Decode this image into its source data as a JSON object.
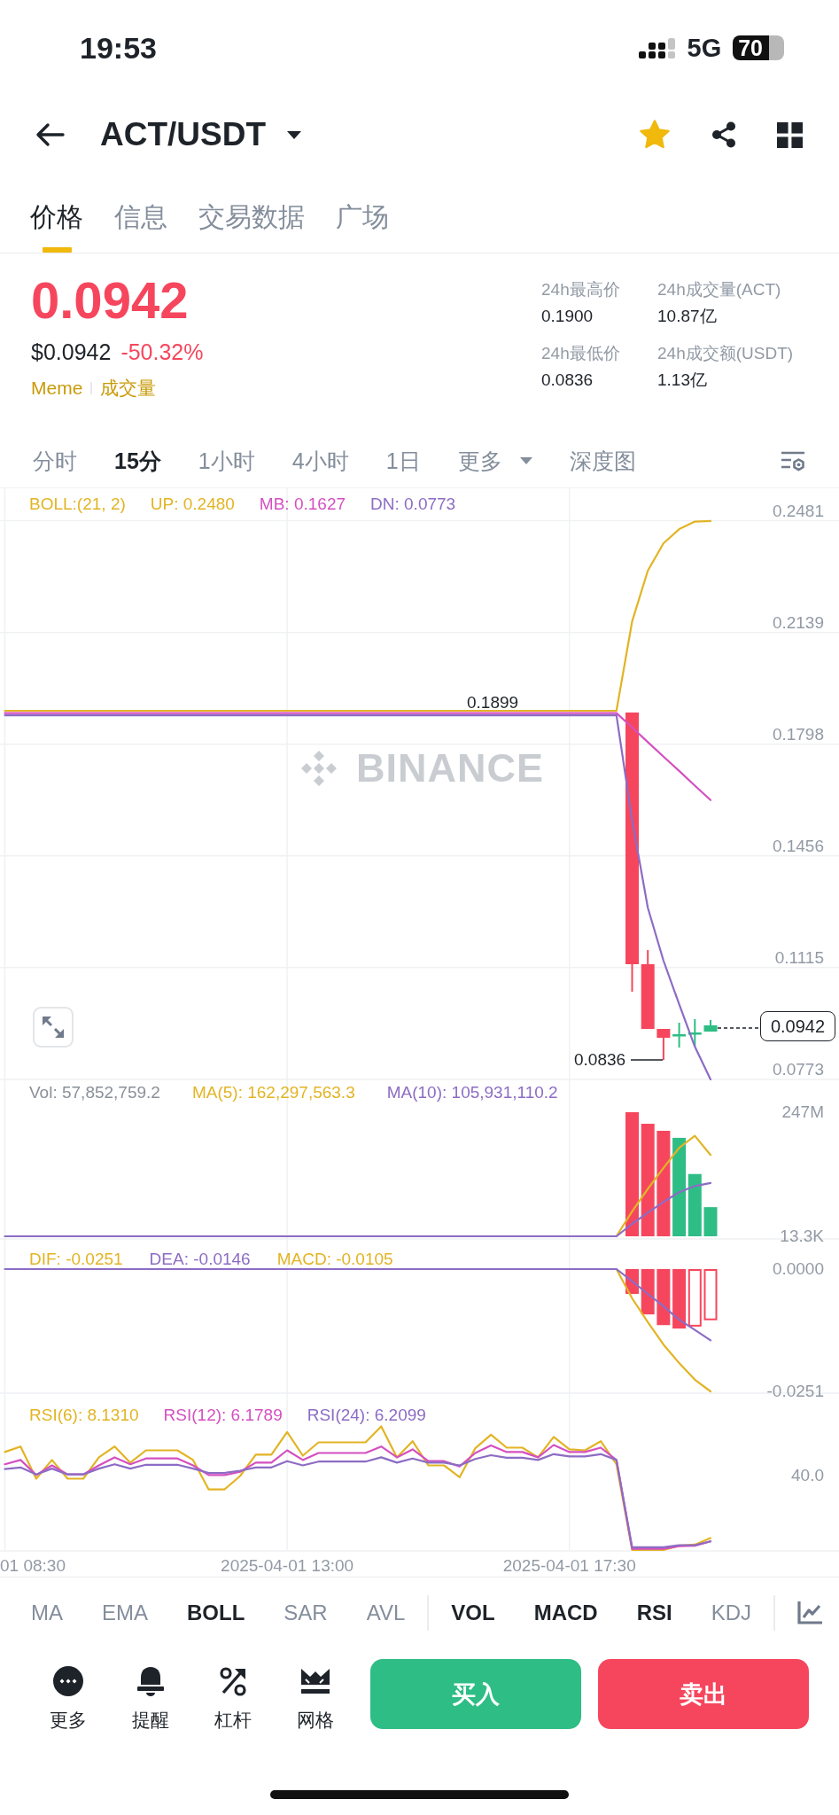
{
  "status_bar": {
    "time": "19:53",
    "network": "5G",
    "battery": "70"
  },
  "header": {
    "pair": "ACT/USDT",
    "favorite": true
  },
  "tabs": [
    {
      "label": "价格",
      "selected": true
    },
    {
      "label": "信息",
      "selected": false
    },
    {
      "label": "交易数据",
      "selected": false
    },
    {
      "label": "广场",
      "selected": false
    }
  ],
  "ticker": {
    "price": "0.0942",
    "usd_price": "$0.0942",
    "change": "-50.32%",
    "down": true,
    "tags": [
      "Meme",
      "成交量"
    ],
    "stats": [
      {
        "label": "24h最高价",
        "value": "0.1900"
      },
      {
        "label": "24h成交量(ACT)",
        "value": "10.87亿"
      },
      {
        "label": "24h最低价",
        "value": "0.0836"
      },
      {
        "label": "24h成交额(USDT)",
        "value": "1.13亿"
      }
    ]
  },
  "intervals": [
    {
      "label": "分时",
      "selected": false,
      "kind": "tab"
    },
    {
      "label": "15分",
      "selected": true,
      "kind": "tab"
    },
    {
      "label": "1小时",
      "selected": false,
      "kind": "tab"
    },
    {
      "label": "4小时",
      "selected": false,
      "kind": "tab"
    },
    {
      "label": "1日",
      "selected": false,
      "kind": "tab"
    },
    {
      "label": "更多",
      "selected": false,
      "kind": "dropdown"
    },
    {
      "label": "深度图",
      "selected": false,
      "kind": "tab"
    }
  ],
  "chart": {
    "main": {
      "legend_label": {
        "text": "BOLL:(21, 2)",
        "color": "#e2b424"
      },
      "watermark": "BINANCE",
      "high_label": "0.1899",
      "low_label": "0.0836",
      "last_price": "0.0942",
      "chart_data": {
        "type": "line",
        "grid": true,
        "categories": [
          null,
          null,
          null,
          null,
          null,
          null,
          null,
          null,
          null,
          null,
          null,
          null,
          null,
          null,
          null,
          null,
          null,
          null,
          null,
          null,
          null,
          null,
          null,
          null,
          null,
          null,
          null,
          null,
          null,
          null,
          null,
          null,
          null,
          null,
          null,
          null,
          null,
          null,
          null,
          null,
          null,
          null,
          null,
          null,
          null,
          null
        ],
        "series": [
          {
            "name": "UP: 0.2480",
            "color": "#e2b424",
            "values": [
              0.19,
              0.19,
              0.19,
              0.19,
              0.19,
              0.19,
              0.19,
              0.19,
              0.19,
              0.19,
              0.19,
              0.19,
              0.19,
              0.19,
              0.19,
              0.19,
              0.19,
              0.19,
              0.19,
              0.19,
              0.19,
              0.19,
              0.19,
              0.19,
              0.19,
              0.19,
              0.19,
              0.19,
              0.19,
              0.19,
              0.19,
              0.19,
              0.19,
              0.19,
              0.19,
              0.19,
              0.19,
              0.19,
              0.19,
              0.19,
              0.2173,
              0.2328,
              0.2412,
              0.2455,
              0.2478,
              0.248
            ]
          },
          {
            "name": "MB: 0.1627",
            "color": "#d450c0",
            "values": [
              0.1893,
              0.1893,
              0.1893,
              0.1893,
              0.1893,
              0.1893,
              0.1893,
              0.1893,
              0.1893,
              0.1893,
              0.1893,
              0.1893,
              0.1893,
              0.1893,
              0.1893,
              0.1893,
              0.1893,
              0.1893,
              0.1893,
              0.1893,
              0.1893,
              0.1893,
              0.1893,
              0.1893,
              0.1893,
              0.1893,
              0.1893,
              0.1893,
              0.1893,
              0.1893,
              0.1893,
              0.1893,
              0.1893,
              0.1893,
              0.1893,
              0.1893,
              0.1893,
              0.1893,
              0.1893,
              0.1893,
              0.1849,
              0.1804,
              0.176,
              0.1716,
              0.1671,
              0.1627
            ]
          },
          {
            "name": "DN: 0.0773",
            "color": "#8c6cc4",
            "values": [
              0.1886,
              0.1886,
              0.1886,
              0.1886,
              0.1886,
              0.1886,
              0.1886,
              0.1886,
              0.1886,
              0.1886,
              0.1886,
              0.1886,
              0.1886,
              0.1886,
              0.1886,
              0.1886,
              0.1886,
              0.1886,
              0.1886,
              0.1886,
              0.1886,
              0.1886,
              0.1886,
              0.1886,
              0.1886,
              0.1886,
              0.1886,
              0.1886,
              0.1886,
              0.1886,
              0.1886,
              0.1886,
              0.1886,
              0.1886,
              0.1886,
              0.1886,
              0.1886,
              0.1886,
              0.1886,
              0.1886,
              0.1566,
              0.1298,
              0.1136,
              0.1003,
              0.0873,
              0.0773
            ]
          }
        ],
        "ylim": [
          0.0773,
          0.2481
        ],
        "yticks": [
          0.2481,
          0.2139,
          0.1798,
          0.1456,
          0.1115,
          0.0773
        ]
      }
    },
    "volume": {
      "legend_label": {
        "text": "Vol: 57,852,759.2",
        "color": "#8a9099"
      },
      "chart_data": {
        "type": "bar",
        "stacked": true,
        "grid": true,
        "categories": [
          null,
          null,
          null,
          null,
          null,
          null,
          null,
          null,
          null,
          null,
          null,
          null,
          null,
          null,
          null,
          null,
          null,
          null,
          null,
          null,
          null,
          null,
          null,
          null,
          null,
          null,
          null,
          null,
          null,
          null,
          null,
          null,
          null,
          null,
          null,
          null,
          null,
          null,
          null,
          null,
          null,
          null,
          null,
          null,
          null,
          null
        ],
        "series": [
          {
            "color": "#f6465d",
            "values": [
              null,
              null,
              null,
              null,
              null,
              null,
              null,
              null,
              null,
              null,
              null,
              null,
              null,
              null,
              null,
              null,
              null,
              null,
              null,
              null,
              null,
              null,
              null,
              null,
              null,
              null,
              null,
              null,
              null,
              null,
              null,
              null,
              null,
              null,
              null,
              null,
              null,
              null,
              null,
              null,
              247000000,
              224000000,
              210000000,
              null,
              null,
              null
            ]
          },
          {
            "color": "#2ebd85",
            "values": [
              null,
              null,
              null,
              null,
              null,
              null,
              null,
              null,
              null,
              null,
              null,
              null,
              null,
              null,
              null,
              null,
              null,
              null,
              null,
              null,
              null,
              null,
              null,
              null,
              null,
              null,
              null,
              null,
              null,
              null,
              null,
              null,
              null,
              null,
              null,
              null,
              null,
              null,
              null,
              null,
              null,
              null,
              null,
              196000000,
              124000000,
              58000000
            ]
          },
          {
            "name": "MA(5): 162,297,563.3",
            "type": "line",
            "color": "#e2b424",
            "values": [
              null,
              null,
              null,
              null,
              null,
              null,
              null,
              null,
              null,
              null,
              null,
              null,
              null,
              null,
              null,
              null,
              null,
              null,
              null,
              null,
              null,
              null,
              null,
              null,
              null,
              null,
              null,
              null,
              null,
              null,
              null,
              null,
              null,
              null,
              null,
              null,
              null,
              null,
              null,
              13300,
              49600000,
              94400000,
              136000000,
              176000000,
              200000000,
              162000000
            ]
          },
          {
            "name": "MA(10): 105,931,110.2",
            "type": "line",
            "color": "#8c6cc4",
            "values": [
              13300,
              13300,
              13300,
              13300,
              13300,
              13300,
              13300,
              13300,
              13300,
              13300,
              13300,
              13300,
              13300,
              13300,
              13300,
              13300,
              13300,
              13300,
              13300,
              13300,
              13300,
              13300,
              13300,
              13300,
              13300,
              13300,
              13300,
              13300,
              13300,
              13300,
              13300,
              13300,
              13300,
              13300,
              13300,
              13300,
              13300,
              13300,
              13300,
              13300,
              24800000,
              47200000,
              68200000,
              87800000,
              100000000,
              106000000
            ]
          }
        ],
        "ylim": [
          13300,
          247000000
        ],
        "yticks": [
          {
            "value": 247000000,
            "label": "247M"
          },
          {
            "value": 13300,
            "label": "13.3K"
          }
        ]
      }
    },
    "macd": {
      "legend_label": {
        "text": "MACD: -0.0105",
        "color": "#e2b424"
      },
      "chart_data": {
        "type": "bar",
        "grid": true,
        "categories": [
          null,
          null,
          null,
          null,
          null,
          null,
          null,
          null,
          null,
          null,
          null,
          null,
          null,
          null,
          null,
          null,
          null,
          null,
          null,
          null,
          null,
          null,
          null,
          null,
          null,
          null,
          null,
          null,
          null,
          null,
          null,
          null,
          null,
          null,
          null,
          null,
          null,
          null,
          null,
          null,
          null,
          null,
          null,
          null,
          null,
          null
        ],
        "series": [
          {
            "color": "#f6465d",
            "values": [
              null,
              null,
              null,
              null,
              null,
              null,
              null,
              null,
              null,
              null,
              null,
              null,
              null,
              null,
              null,
              null,
              null,
              null,
              null,
              null,
              null,
              null,
              null,
              null,
              null,
              null,
              null,
              null,
              null,
              null,
              null,
              null,
              null,
              null,
              null,
              null,
              null,
              null,
              null,
              null,
              -0.0051,
              -0.0093,
              -0.0115,
              -0.0122,
              -0.0118,
              -0.0105
            ]
          },
          {
            "name": "DIF: -0.0251",
            "type": "line",
            "color": "#e2b424",
            "values": [
              null,
              null,
              null,
              null,
              null,
              null,
              null,
              null,
              null,
              null,
              null,
              null,
              null,
              null,
              null,
              null,
              null,
              null,
              null,
              null,
              null,
              null,
              null,
              null,
              null,
              null,
              null,
              null,
              null,
              null,
              null,
              null,
              null,
              null,
              null,
              null,
              null,
              null,
              null,
              0,
              -0.006,
              -0.0109,
              -0.0155,
              -0.0193,
              -0.0227,
              -0.0251
            ]
          },
          {
            "name": "DEA: -0.0146",
            "type": "line",
            "color": "#8c6cc4",
            "values": [
              0,
              0,
              0,
              0,
              0,
              0,
              0,
              0,
              0,
              0,
              0,
              0,
              0,
              0,
              0,
              0,
              0,
              0,
              0,
              0,
              0,
              0,
              0,
              0,
              0,
              0,
              0,
              0,
              0,
              0,
              0,
              0,
              0,
              0,
              0,
              0,
              0,
              0,
              0,
              0,
              -0.0025,
              -0.0051,
              -0.0076,
              -0.0104,
              -0.0125,
              -0.0146
            ]
          }
        ],
        "ylim": [
          -0.0251,
          0
        ],
        "yticks": [
          {
            "value": 0,
            "label": "0.0000"
          },
          -0.0251
        ]
      }
    },
    "rsi": {
      "legend": [
        {
          "text": "RSI(6): 8.1310",
          "color": "#e2b424"
        },
        {
          "text": "RSI(12): 6.1789",
          "color": "#d450c0"
        },
        {
          "text": "RSI(24): 6.2099",
          "color": "#8c6cc4"
        }
      ],
      "axis_label": "40.0"
    },
    "time_axis": [
      "01 08:30",
      "2025-04-01 13:00",
      "2025-04-01 17:30"
    ]
  },
  "indicators": {
    "main": [
      {
        "label": "MA",
        "selected": false
      },
      {
        "label": "EMA",
        "selected": false
      },
      {
        "label": "BOLL",
        "selected": true
      },
      {
        "label": "SAR",
        "selected": false
      },
      {
        "label": "AVL",
        "selected": false
      }
    ],
    "sub": [
      {
        "label": "VOL",
        "selected": true
      },
      {
        "label": "MACD",
        "selected": true
      },
      {
        "label": "RSI",
        "selected": true
      },
      {
        "label": "KDJ",
        "selected": false
      }
    ]
  },
  "actions": [
    {
      "label": "更多",
      "kind": "more"
    },
    {
      "label": "提醒",
      "kind": "alert"
    },
    {
      "label": "杠杆",
      "kind": "margin"
    },
    {
      "label": "网格",
      "kind": "grid"
    }
  ],
  "trade_buttons": [
    {
      "label": "买入",
      "kind": "buy"
    },
    {
      "label": "卖出",
      "kind": "sell"
    }
  ]
}
